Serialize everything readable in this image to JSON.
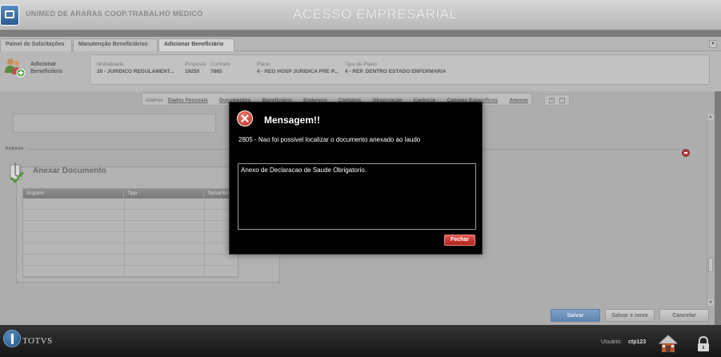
{
  "header": {
    "company": "UNIMED DE ARARAS COOP.TRABALHO MEDICO",
    "app_title": "ACESSO EMPRESARIAL"
  },
  "tabs": [
    {
      "label": "Painel de Solicitações"
    },
    {
      "label": "Manutenção Beneficiários"
    },
    {
      "label": "Adicionar Beneficiário"
    }
  ],
  "info": {
    "title": "Adicionar Beneficiário",
    "fields": [
      {
        "label": "Modalidade",
        "value": "20 - JURIDICO REGULAMENT..."
      },
      {
        "label": "Proposta",
        "value": "19250"
      },
      {
        "label": "Contrato",
        "value": "7865"
      },
      {
        "label": "Plano",
        "value": "4 - REG HOSP JURIDICA PRE P..."
      },
      {
        "label": "Tipo de Plano",
        "value": "4 - REP. DENTRO ESTADO ENFERMARIA"
      }
    ]
  },
  "shortcuts": {
    "label": "Atalhos",
    "links": [
      "Dados Pessoais",
      "Documentos",
      "Beneficiário",
      "Endereço",
      "Contatos",
      "Observação",
      "Carência",
      "Campos Específicos",
      "Anexos"
    ]
  },
  "section": {
    "anexos_label": "Anexos",
    "anexar_title": "Anexar Documento",
    "columns": [
      "Arquivo",
      "Tipo",
      "Tamanho"
    ]
  },
  "actions": {
    "save": "Salvar",
    "save_new": "Salvar e novo",
    "cancel": "Cancelar"
  },
  "footer": {
    "brand": "TOTVS",
    "user_label": "Usuário:",
    "user_value": "ctp123"
  },
  "modal": {
    "title": "Mensagem!!",
    "message": "2805 - Nao foi possivel localizar o documento anexado ao laudo",
    "detail": "Anexo de Declaracao de Saude Obrigatorio.",
    "close_label": "Fechar"
  },
  "colors": {
    "accent": "#5f84b0",
    "danger": "#c0281c",
    "modal_bg": "#000000"
  }
}
